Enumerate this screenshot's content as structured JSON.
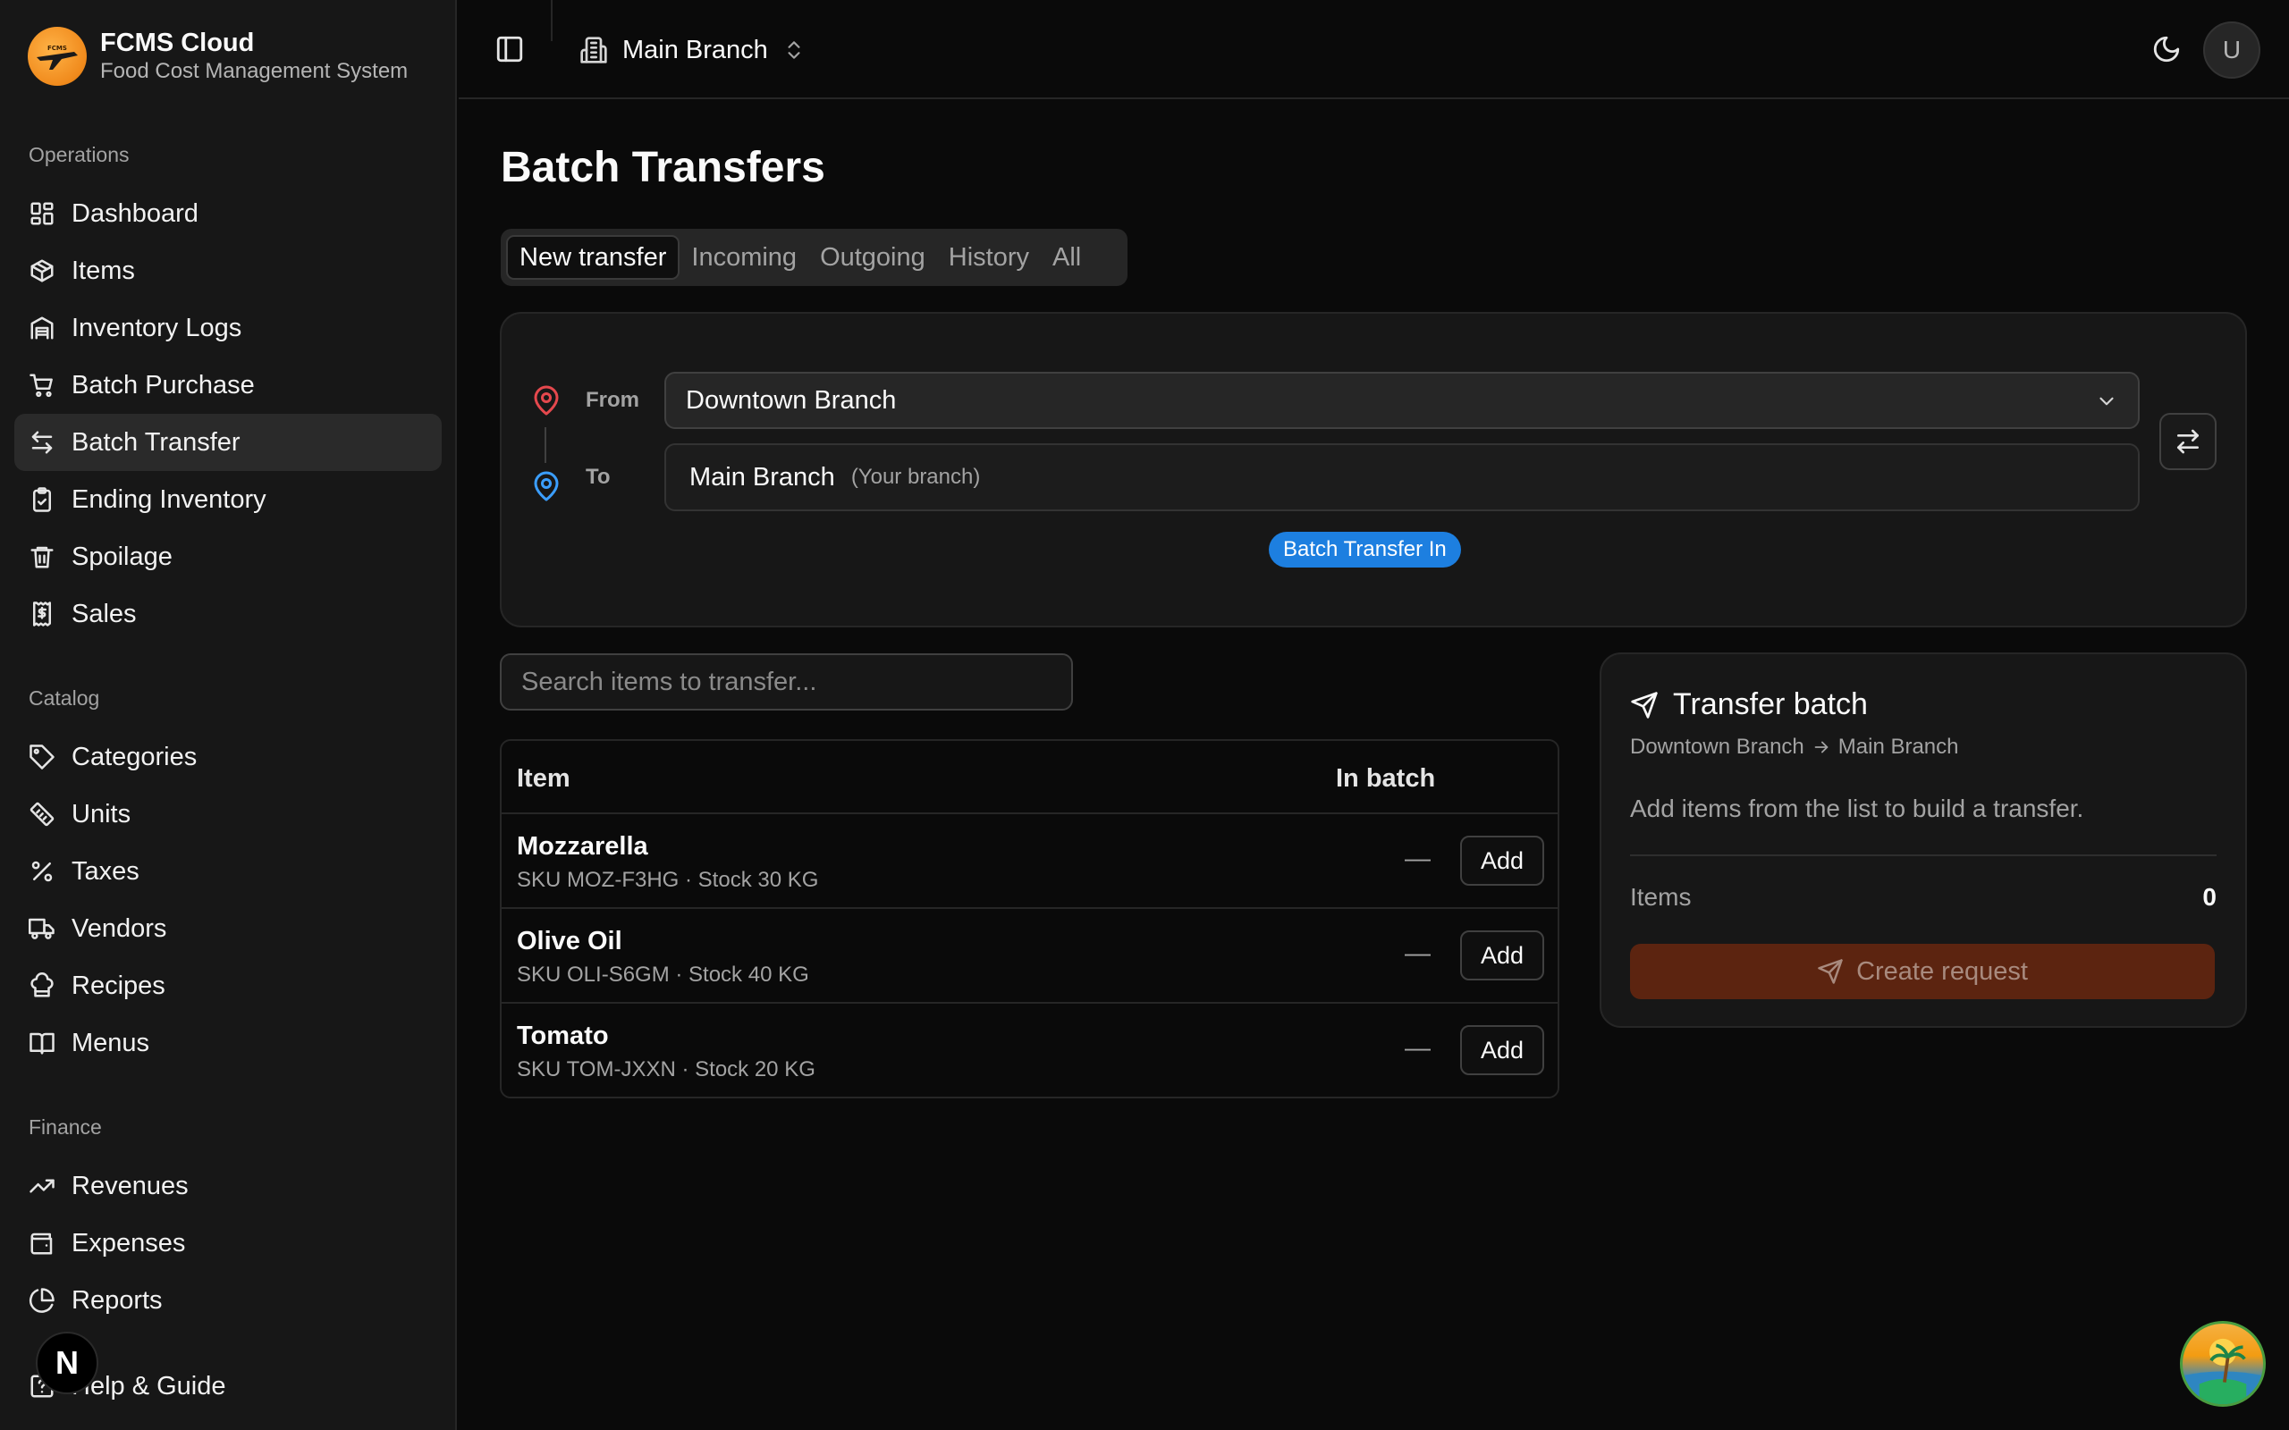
{
  "brand": {
    "title": "FCMS Cloud",
    "subtitle": "Food Cost Management System",
    "logo_text": "FCMS"
  },
  "sidebar": {
    "groups": [
      {
        "label": "Operations",
        "items": [
          "Dashboard",
          "Items",
          "Inventory Logs",
          "Batch Purchase",
          "Batch Transfer",
          "Ending Inventory",
          "Spoilage",
          "Sales"
        ]
      },
      {
        "label": "Catalog",
        "items": [
          "Categories",
          "Units",
          "Taxes",
          "Vendors",
          "Recipes",
          "Menus"
        ]
      },
      {
        "label": "Finance",
        "items": [
          "Revenues",
          "Expenses",
          "Reports"
        ]
      }
    ],
    "active_item": "Batch Transfer",
    "footer_item": "Help & Guide",
    "dev_badge": "N"
  },
  "topbar": {
    "branch": "Main Branch",
    "avatar_initial": "U"
  },
  "page": {
    "title": "Batch Transfers",
    "tabs": [
      "New transfer",
      "Incoming",
      "Outgoing",
      "History",
      "All"
    ],
    "active_tab": "New transfer"
  },
  "route": {
    "from_label": "From",
    "from_value": "Downtown Branch",
    "to_label": "To",
    "to_value": "Main Branch",
    "to_note": "(Your branch)",
    "badge": "Batch Transfer In"
  },
  "search": {
    "placeholder": "Search items to transfer..."
  },
  "table": {
    "headers": {
      "item": "Item",
      "in_batch": "In batch"
    },
    "rows": [
      {
        "name": "Mozzarella",
        "meta": "SKU MOZ-F3HG · Stock 30 KG",
        "in_batch": "—",
        "action": "Add"
      },
      {
        "name": "Olive Oil",
        "meta": "SKU OLI-S6GM · Stock 40 KG",
        "in_batch": "—",
        "action": "Add"
      },
      {
        "name": "Tomato",
        "meta": "SKU TOM-JXXN · Stock 20 KG",
        "in_batch": "—",
        "action": "Add"
      }
    ]
  },
  "batch": {
    "title": "Transfer batch",
    "route_from": "Downtown Branch",
    "route_to": "Main Branch",
    "hint": "Add items from the list to build a transfer.",
    "items_label": "Items",
    "items_count": "0",
    "create_label": "Create request"
  },
  "colors": {
    "accent_blue": "#1d7fe0",
    "from_pin": "#e5484d",
    "to_pin": "#3b9eff",
    "create_button": "#5c2410"
  },
  "icons": {
    "nav": [
      "dashboard-icon",
      "package-icon",
      "warehouse-icon",
      "cart-icon",
      "transfer-icon",
      "clipboard-check-icon",
      "trash-icon",
      "receipt-dollar-icon",
      "tag-icon",
      "ruler-icon",
      "percent-icon",
      "truck-icon",
      "chef-hat-icon",
      "book-icon",
      "trending-up-icon",
      "wallet-icon",
      "pie-chart-icon",
      "help-icon"
    ]
  }
}
